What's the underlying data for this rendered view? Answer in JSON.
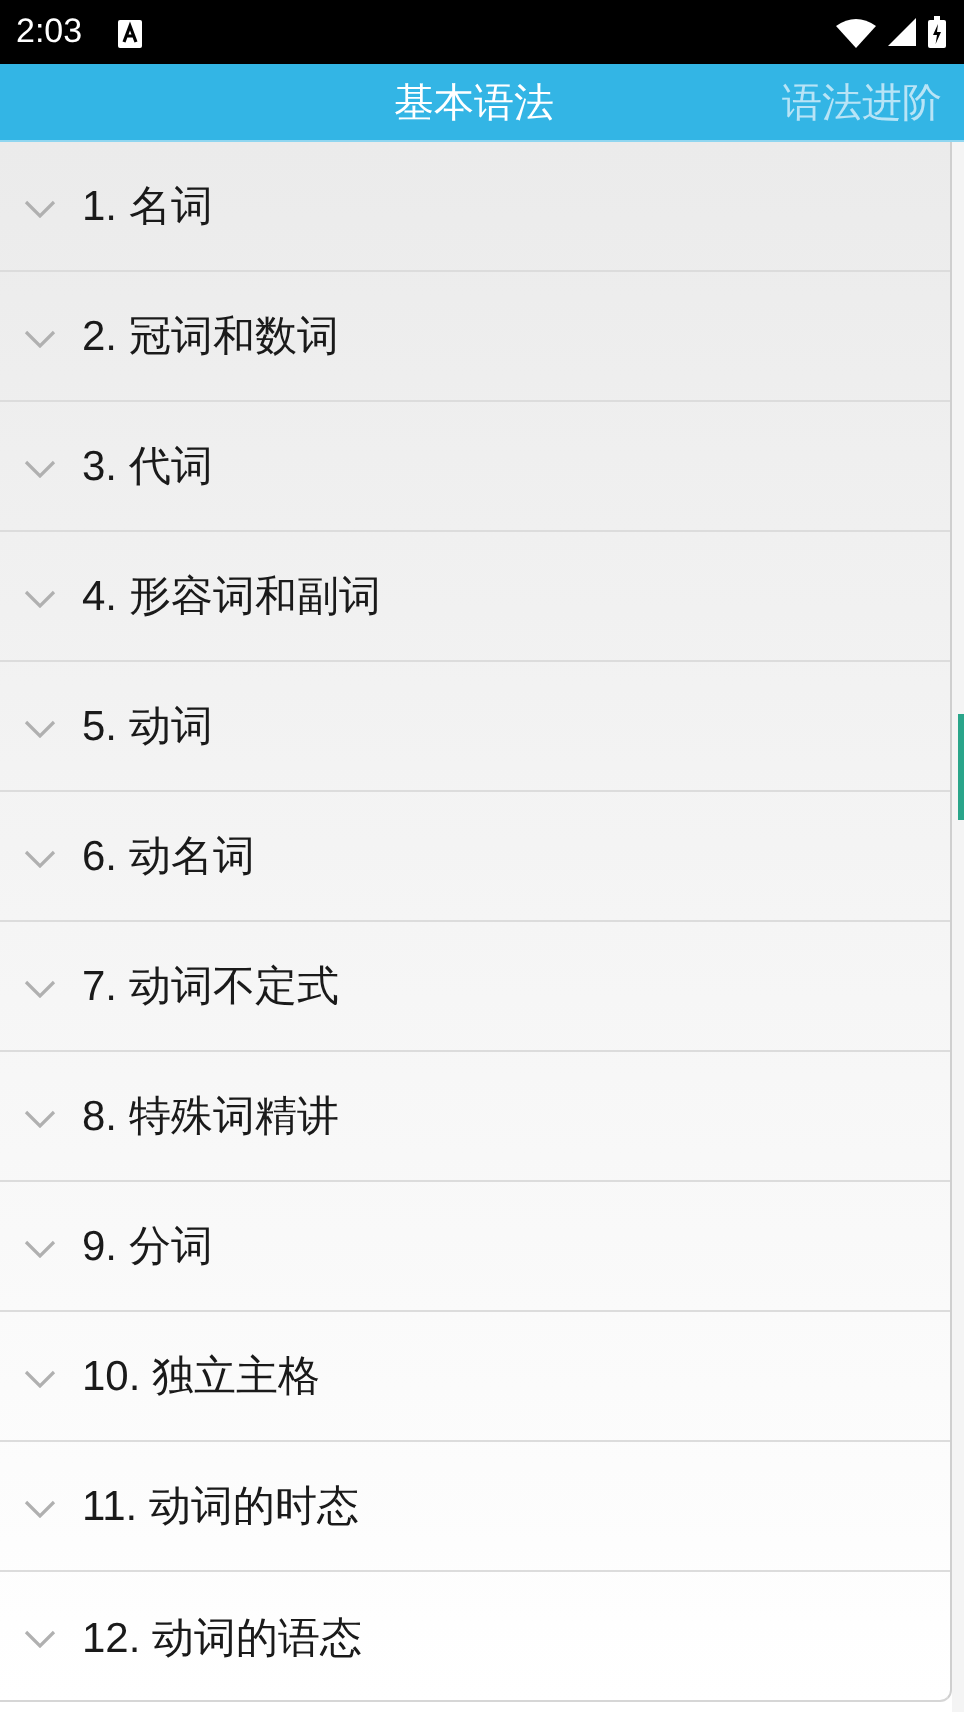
{
  "status_bar": {
    "time": "2:03"
  },
  "tabs": [
    {
      "label": "基本语法",
      "selected": true
    },
    {
      "label": "语法进阶",
      "selected": false
    }
  ],
  "sections": [
    {
      "label": "1. 名词",
      "expanded": false
    },
    {
      "label": "2. 冠词和数词",
      "expanded": false
    },
    {
      "label": "3. 代词",
      "expanded": false
    },
    {
      "label": "4. 形容词和副词",
      "expanded": false
    },
    {
      "label": "5. 动词",
      "expanded": false
    },
    {
      "label": "6. 动名词",
      "expanded": false
    },
    {
      "label": "7. 动词不定式",
      "expanded": false
    },
    {
      "label": "8. 特殊词精讲",
      "expanded": false
    },
    {
      "label": "9. 分词",
      "expanded": false
    },
    {
      "label": "10. 独立主格",
      "expanded": false
    },
    {
      "label": "11. 动词的时态",
      "expanded": false
    },
    {
      "label": "12. 动词的语态",
      "expanded": false
    }
  ]
}
